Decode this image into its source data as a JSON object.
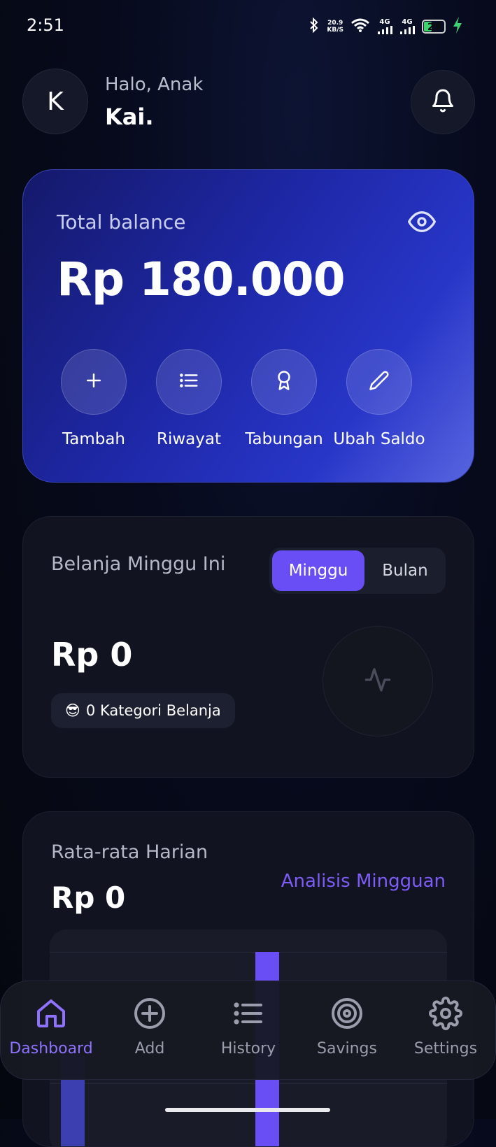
{
  "status_bar": {
    "time": "2:51",
    "net_speed_value": "20.9",
    "net_speed_unit": "KB/S",
    "signal1_label": "4G",
    "signal2_label": "4G",
    "battery_level": "29"
  },
  "header": {
    "avatar_initial": "K",
    "greeting": "Halo, Anak",
    "name": "Kai."
  },
  "balance_card": {
    "label": "Total balance",
    "amount": "Rp 180.000",
    "actions": [
      {
        "label": "Tambah",
        "icon": "plus-icon"
      },
      {
        "label": "Riwayat",
        "icon": "list-icon"
      },
      {
        "label": "Tabungan",
        "icon": "award-icon"
      },
      {
        "label": "Ubah Saldo",
        "icon": "pencil-icon"
      }
    ]
  },
  "weekly_card": {
    "title": "Belanja Minggu Ini",
    "toggle": {
      "active": "Minggu",
      "inactive": "Bulan"
    },
    "amount": "Rp 0",
    "chip_emoji": "😎",
    "chip_text": "0 Kategori Belanja",
    "icon": "activity-icon"
  },
  "daily_card": {
    "title": "Rata-rata Harian",
    "amount": "Rp 0",
    "link": "Analisis Mingguan"
  },
  "bottom_nav": {
    "items": [
      {
        "label": "Dashboard",
        "icon": "home-icon",
        "active": true
      },
      {
        "label": "Add",
        "icon": "plus-circle-icon",
        "active": false
      },
      {
        "label": "History",
        "icon": "list-icon",
        "active": false
      },
      {
        "label": "Savings",
        "icon": "target-icon",
        "active": false
      },
      {
        "label": "Settings",
        "icon": "gear-icon",
        "active": false
      }
    ]
  },
  "colors": {
    "accent": "#6a4ef5",
    "card_gradient_start": "#15196a",
    "card_gradient_end": "#5865e0",
    "background": "#070a1c"
  }
}
